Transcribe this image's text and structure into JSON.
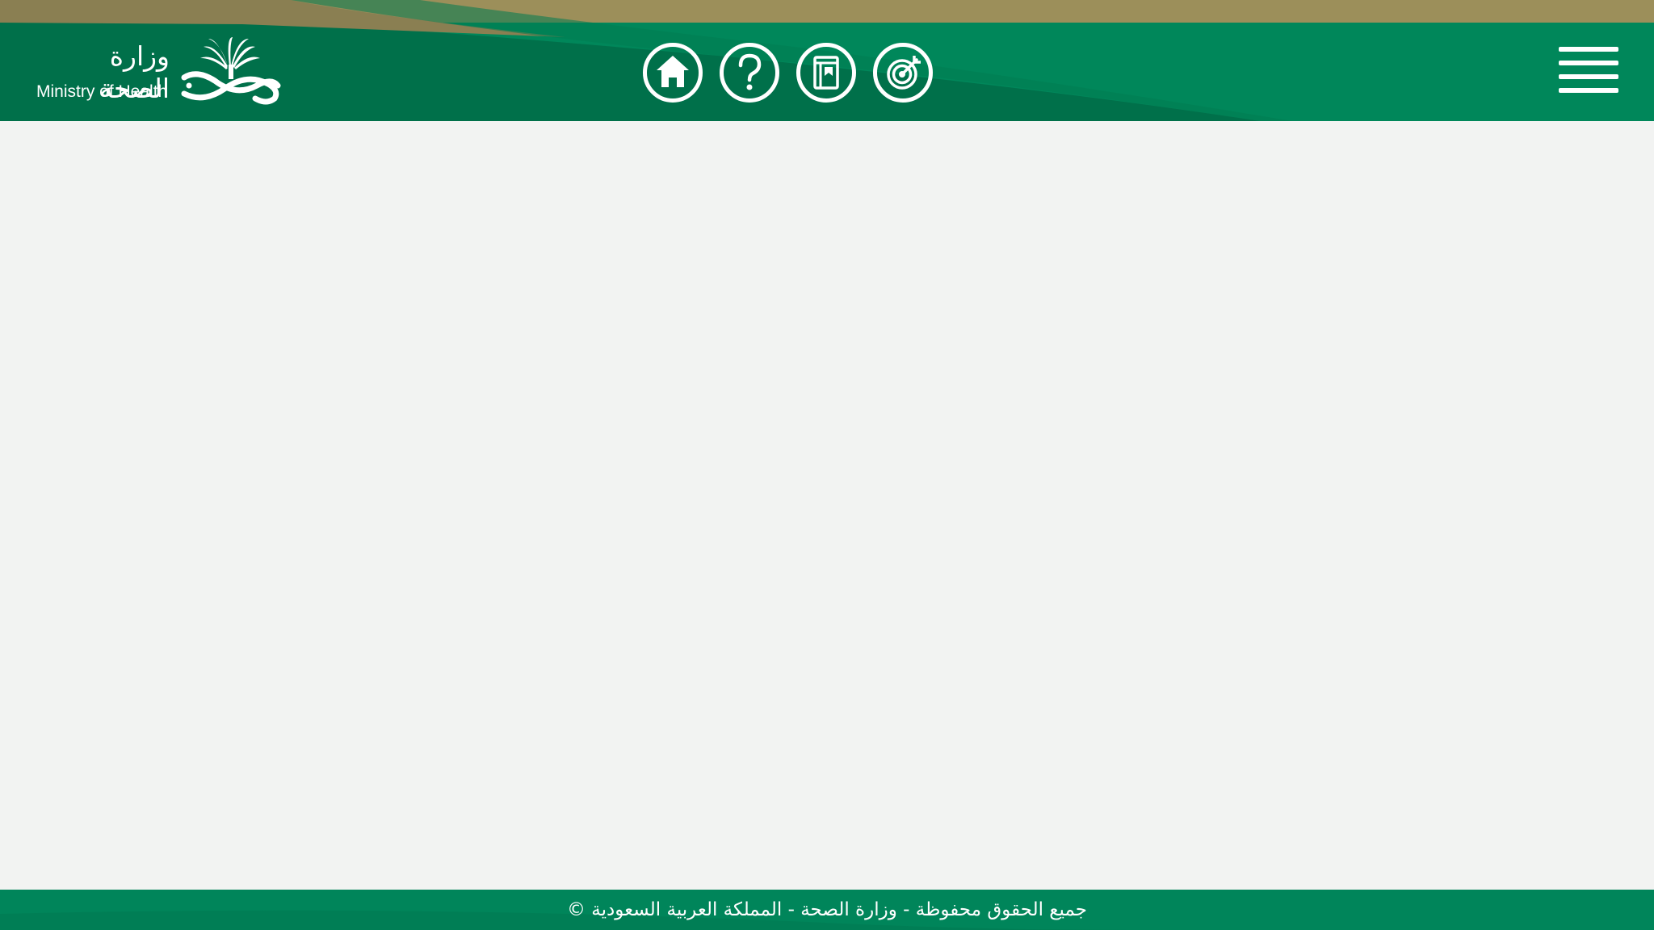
{
  "header": {
    "logo": {
      "name_ar": "وزارة الصحة",
      "name_en": "Ministry of Health",
      "emblem_icon": "palm-and-swords-emblem-icon"
    },
    "nav_buttons": [
      {
        "icon": "home-icon"
      },
      {
        "icon": "question-mark-icon"
      },
      {
        "icon": "book-icon"
      },
      {
        "icon": "target-icon"
      }
    ],
    "menu_icon": "hamburger-menu-icon"
  },
  "footer": {
    "copyright": "جميع الحقوق محفوظة - وزارة الصحة - المملكة العربية السعودية ©"
  },
  "colors": {
    "header_green": "#00875a",
    "header_dark_green": "#00704a",
    "header_gold": "#9c8f5a",
    "content_bg": "#f2f3f2",
    "footer_green": "#00855a",
    "icon_white": "#ffffff"
  }
}
